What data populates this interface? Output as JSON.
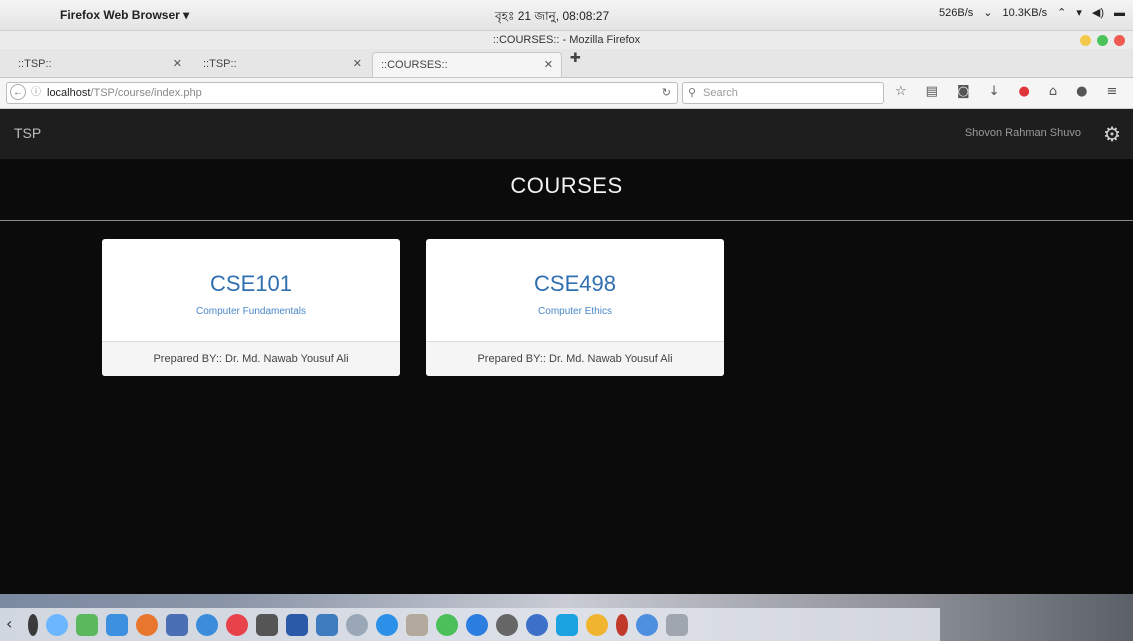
{
  "os": {
    "app_name": "Firefox Web Browser ▾",
    "clock": "বৃহঃ 21 জানু, 08:08:27",
    "net_down": "526B/s",
    "net_up": "10.3KB/s"
  },
  "window": {
    "title": "::COURSES:: - Mozilla Firefox"
  },
  "tabs": [
    {
      "label": "::TSP::"
    },
    {
      "label": "::TSP::"
    },
    {
      "label": "::COURSES::"
    }
  ],
  "navbar": {
    "url_host": "localhost",
    "url_path": "/TSP/course/index.php",
    "search_placeholder": "Search"
  },
  "page": {
    "brand": "TSP",
    "user_name": "Shovon Rahman Shuvo",
    "title": "COURSES",
    "courses": [
      {
        "code": "CSE101",
        "name": "Computer Fundamentals",
        "prepared_by": "Prepared BY:: Dr. Md. Nawab Yousuf Ali"
      },
      {
        "code": "CSE498",
        "name": "Computer Ethics",
        "prepared_by": "Prepared BY:: Dr. Md. Nawab Yousuf Ali"
      }
    ]
  },
  "colors": {
    "page_bg": "#0b0b0b",
    "course_code": "#2f6fb0",
    "course_name": "#4a87c6"
  }
}
